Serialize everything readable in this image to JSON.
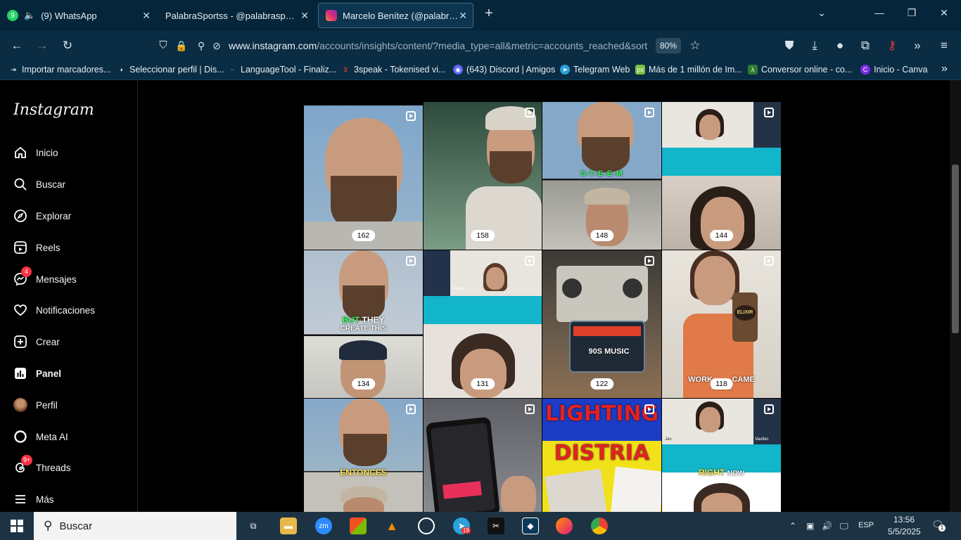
{
  "browser": {
    "tabs": [
      {
        "title": "(9) WhatsApp",
        "badge": "9"
      },
      {
        "title": "PalabraSportss - @palabrasportss |"
      },
      {
        "title": "Marcelo Benítez (@palabr4ss) •"
      }
    ],
    "url_host": "www.instagram.com",
    "url_path": "/accounts/insights/content/?media_type=all&metric=accounts_reached&sort",
    "zoom": "80%",
    "bookmarks": [
      "Importar marcadores...",
      "Seleccionar perfil | Dis...",
      "LanguageTool - Finaliz...",
      "3speak - Tokenised vi...",
      "(643) Discord | Amigos",
      "Telegram Web",
      "Más de 1 millón de Im...",
      "Conversor online - co...",
      "Inicio - Canva"
    ]
  },
  "instagram": {
    "logo": "Instagram",
    "nav": [
      {
        "label": "Inicio",
        "icon": "home-icon"
      },
      {
        "label": "Buscar",
        "icon": "search-icon"
      },
      {
        "label": "Explorar",
        "icon": "compass-icon"
      },
      {
        "label": "Reels",
        "icon": "reels-icon"
      },
      {
        "label": "Mensajes",
        "icon": "messenger-icon",
        "badge": "4"
      },
      {
        "label": "Notificaciones",
        "icon": "heart-icon"
      },
      {
        "label": "Crear",
        "icon": "plus-square-icon"
      },
      {
        "label": "Panel",
        "icon": "chart-icon"
      },
      {
        "label": "Perfil",
        "icon": "avatar-icon"
      },
      {
        "label": "Meta AI",
        "icon": "meta-ai-icon"
      },
      {
        "label": "Threads",
        "icon": "threads-icon",
        "badge": "9+"
      },
      {
        "label": "Más",
        "icon": "menu-icon"
      }
    ],
    "posts": [
      {
        "count": "162"
      },
      {
        "count": "158"
      },
      {
        "count": "148",
        "caption": "S-T-E-E-M"
      },
      {
        "count": "144"
      },
      {
        "count": "134",
        "caption_a": "BUT",
        "caption_b": "THEY",
        "caption_c": "CREATE THIS"
      },
      {
        "count": "131",
        "label": "Vaultec"
      },
      {
        "count": "122",
        "caption": "90S MUSIC"
      },
      {
        "count": "118",
        "caption_a": "WORK",
        "caption_b": "CAME",
        "caption_c": "FROM",
        "logo": "ELIXIR"
      },
      {
        "caption": "ENTONCES"
      },
      {},
      {
        "caption_a": "LIGHTING",
        "caption_b": "DISTRIA"
      },
      {
        "caption_a": "RIGHT",
        "caption_b": "NOW",
        "label": "Vaultec",
        "name": "Jan"
      }
    ]
  },
  "taskbar": {
    "search_label": "Buscar",
    "telegram_badge": "19",
    "language": "ESP",
    "time": "13:56",
    "date": "5/5/2025",
    "notif_count": "1"
  }
}
